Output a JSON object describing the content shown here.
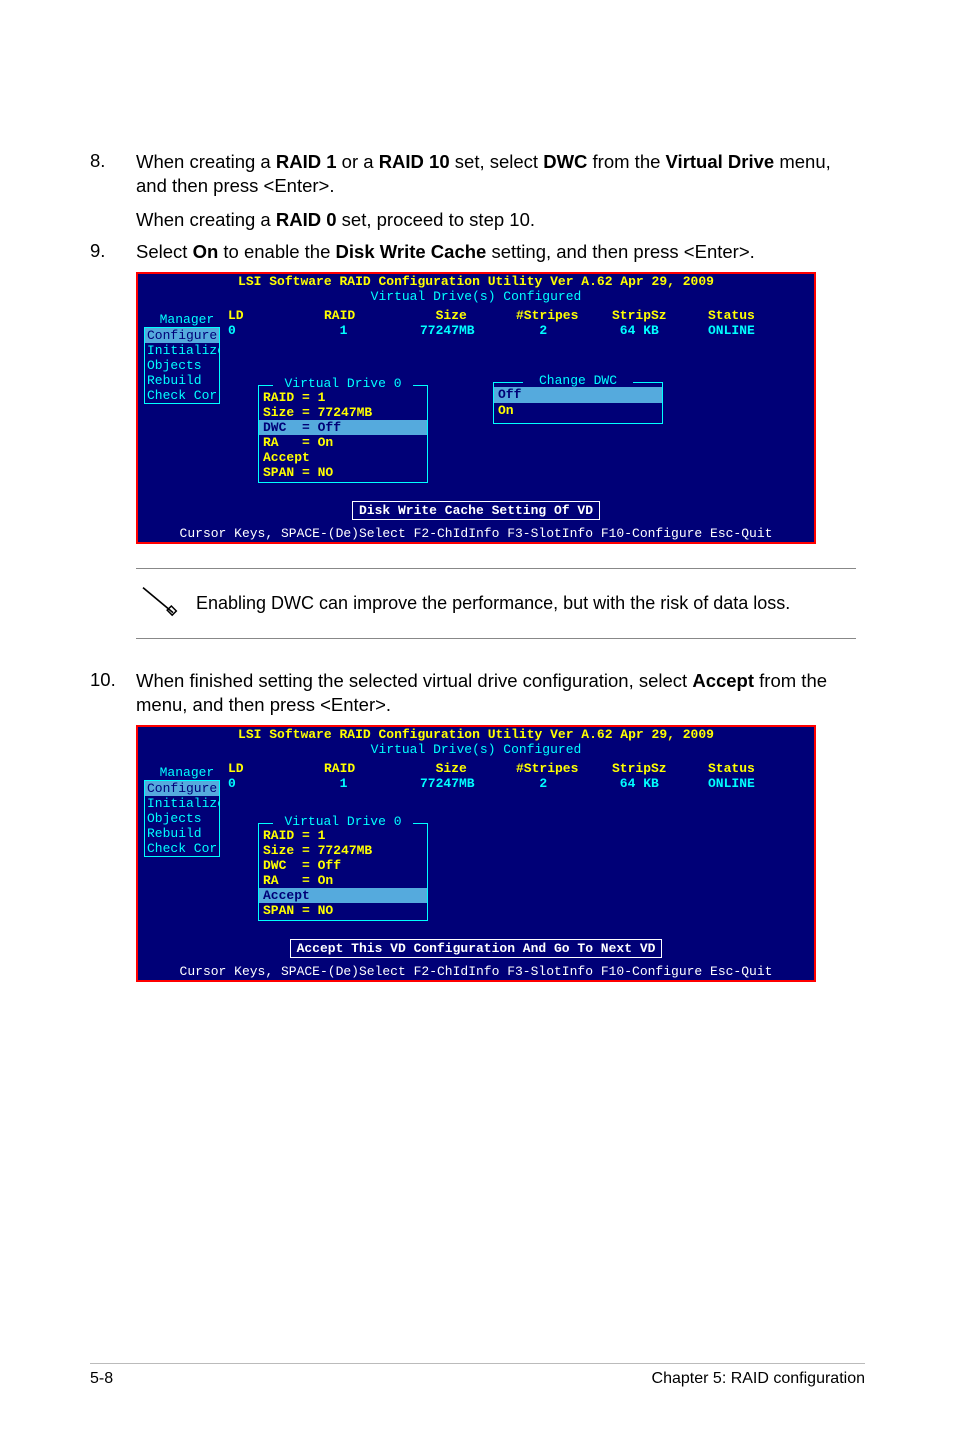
{
  "steps": {
    "s8_num": "8.",
    "s8_a": "When creating a ",
    "s8_raid1": "RAID 1",
    "s8_b": " or a ",
    "s8_raid10": "RAID 10",
    "s8_c": " set, select ",
    "s8_dwc": "DWC",
    "s8_d": " from the ",
    "s8_vd": "Virtual Drive",
    "s8_e": " menu, and then press <Enter>.",
    "s8_cont_a": "When creating a ",
    "s8_raid0": "RAID 0",
    "s8_cont_b": " set, proceed to step 10.",
    "s9_num": "9.",
    "s9_a": "Select ",
    "s9_on": "On",
    "s9_b": " to enable the ",
    "s9_dwc": "Disk Write Cache",
    "s9_c": " setting, and then press <Enter>.",
    "s10_num": "10.",
    "s10_a": "When finished setting the selected virtual drive configuration, select ",
    "s10_accept": "Accept",
    "s10_b": " from the menu, and then press <Enter>."
  },
  "note": "Enabling DWC can improve the performance, but with the risk of data loss.",
  "bios": {
    "title": "LSI Software RAID Configuration Utility Ver A.62 Apr 29, 2009",
    "subtitle": "Virtual Drive(s) Configured",
    "hdr": {
      "ld": "LD",
      "raid": "RAID",
      "size": "  Size",
      "stripes": "#Stripes",
      "stripsz": "StripSz",
      "status": "Status"
    },
    "val": {
      "ld": "0 ",
      "raid": "  1 ",
      "size": "77247MB",
      "stripes": "   2",
      "stripsz": " 64 KB",
      "status": "ONLINE"
    },
    "menu_label": "Manager",
    "menu": [
      "Configure",
      "Initialize",
      "Objects",
      "Rebuild",
      "Check Cor"
    ],
    "menu_sel_index": 0,
    "vd_title": "Virtual Drive 0",
    "vd_lines": [
      "RAID = 1",
      "Size = 77247MB",
      "DWC  = Off",
      "RA   = On",
      "Accept",
      "SPAN = NO"
    ],
    "vd_sel_index_a": 2,
    "vd_sel_index_b": 4,
    "popup_title": "Change DWC",
    "popup_items": [
      "Off",
      "On"
    ],
    "popup_sel_index": 0,
    "prompt_a": "Disk Write Cache Setting Of VD",
    "prompt_b": "Accept This VD Configuration And Go To Next VD",
    "footer": "Cursor Keys, SPACE-(De)Select F2-ChIdInfo F3-SlotInfo F10-Configure Esc-Quit"
  },
  "page_footer": {
    "left": "5-8",
    "right": "Chapter 5: RAID configuration"
  }
}
